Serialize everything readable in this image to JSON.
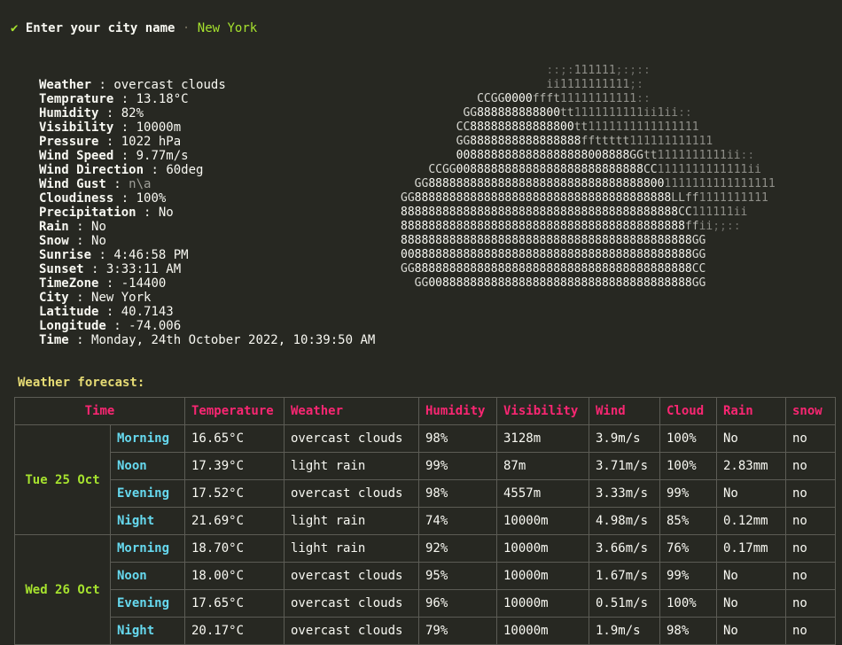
{
  "prompt": {
    "check": "✔",
    "question": "Enter your city name",
    "separator": "·",
    "answer": "New York"
  },
  "current": [
    {
      "label": "Weather",
      "value": "overcast clouds"
    },
    {
      "label": "Temprature",
      "value": "13.18°C"
    },
    {
      "label": "Humidity",
      "value": "82%"
    },
    {
      "label": "Visibility",
      "value": "10000m"
    },
    {
      "label": "Pressure",
      "value": "1022 hPa"
    },
    {
      "label": "Wind Speed",
      "value": "9.77m/s"
    },
    {
      "label": "Wind Direction",
      "value": "60deg"
    },
    {
      "label": "Wind Gust",
      "value": "n\\a"
    },
    {
      "label": "Cloudiness",
      "value": "100%"
    },
    {
      "label": "Precipitation",
      "value": "No"
    },
    {
      "label": "Rain",
      "value": "No"
    },
    {
      "label": "Snow",
      "value": "No"
    },
    {
      "label": "Sunrise",
      "value": "4:46:58 PM"
    },
    {
      "label": "Sunset",
      "value": "3:33:11 AM"
    },
    {
      "label": "TimeZone",
      "value": "-14400"
    },
    {
      "label": "City",
      "value": "New York"
    },
    {
      "label": "Latitude",
      "value": "40.7143"
    },
    {
      "label": "Longitude",
      "value": "-74.006"
    },
    {
      "label": "Time",
      "value": "Monday, 24th October 2022, 10:39:50 AM"
    }
  ],
  "art": [
    "                     ::;:111111;:;::",
    "                     ii1111111111;:",
    "           CCGG0000ffft11111111111::",
    "         GG888888888800tt1111111111ii1ii::",
    "        CC888888888888800tt1111111111111111",
    "        GG8888888888888888ffttttt111111111111",
    "        0088888888888888888008888GGtt1111111111ii::",
    "    CCGG008888888888888888888888888CC1111111111111ii",
    "  GG88888888888888888888888888888888001111111111111111",
    "GG8888888888888888888888888888888888888LLff1111111111",
    "8888888888888888888888888888888888888888CC111111ii",
    "88888888888888888888888888888888888888888ffii;;::",
    "888888888888888888888888888888888888888888GG",
    "008888888888888888888888888888888888888888GG",
    "GG8888888888888888888888888888888888888888CC",
    "  GG00888888888888888888888888888888888888GG"
  ],
  "forecast": {
    "title": "Weather forecast:",
    "headers": [
      "Time",
      "Temperature",
      "Weather",
      "Humidity",
      "Visibility",
      "Wind",
      "Cloud",
      "Rain",
      "snow"
    ],
    "days": [
      {
        "date": "Tue 25 Oct",
        "rows": [
          {
            "period": "Morning",
            "temp": "16.65°C",
            "weather": "overcast clouds",
            "humidity": "98%",
            "visibility": "3128m",
            "wind": "3.9m/s",
            "cloud": "100%",
            "rain": "No",
            "snow": "no"
          },
          {
            "period": "Noon",
            "temp": "17.39°C",
            "weather": "light rain",
            "humidity": "99%",
            "visibility": "87m",
            "wind": "3.71m/s",
            "cloud": "100%",
            "rain": "2.83mm",
            "snow": "no"
          },
          {
            "period": "Evening",
            "temp": "17.52°C",
            "weather": "overcast clouds",
            "humidity": "98%",
            "visibility": "4557m",
            "wind": "3.33m/s",
            "cloud": "99%",
            "rain": "No",
            "snow": "no"
          },
          {
            "period": "Night",
            "temp": "21.69°C",
            "weather": "light rain",
            "humidity": "74%",
            "visibility": "10000m",
            "wind": "4.98m/s",
            "cloud": "85%",
            "rain": "0.12mm",
            "snow": "no"
          }
        ]
      },
      {
        "date": "Wed 26 Oct",
        "rows": [
          {
            "period": "Morning",
            "temp": "18.70°C",
            "weather": "light rain",
            "humidity": "92%",
            "visibility": "10000m",
            "wind": "3.66m/s",
            "cloud": "76%",
            "rain": "0.17mm",
            "snow": "no"
          },
          {
            "period": "Noon",
            "temp": "18.00°C",
            "weather": "overcast clouds",
            "humidity": "95%",
            "visibility": "10000m",
            "wind": "1.67m/s",
            "cloud": "99%",
            "rain": "No",
            "snow": "no"
          },
          {
            "period": "Evening",
            "temp": "17.65°C",
            "weather": "overcast clouds",
            "humidity": "96%",
            "visibility": "10000m",
            "wind": "0.51m/s",
            "cloud": "100%",
            "rain": "No",
            "snow": "no"
          },
          {
            "period": "Night",
            "temp": "20.17°C",
            "weather": "overcast clouds",
            "humidity": "79%",
            "visibility": "10000m",
            "wind": "1.9m/s",
            "cloud": "98%",
            "rain": "No",
            "snow": "no"
          }
        ]
      }
    ]
  }
}
